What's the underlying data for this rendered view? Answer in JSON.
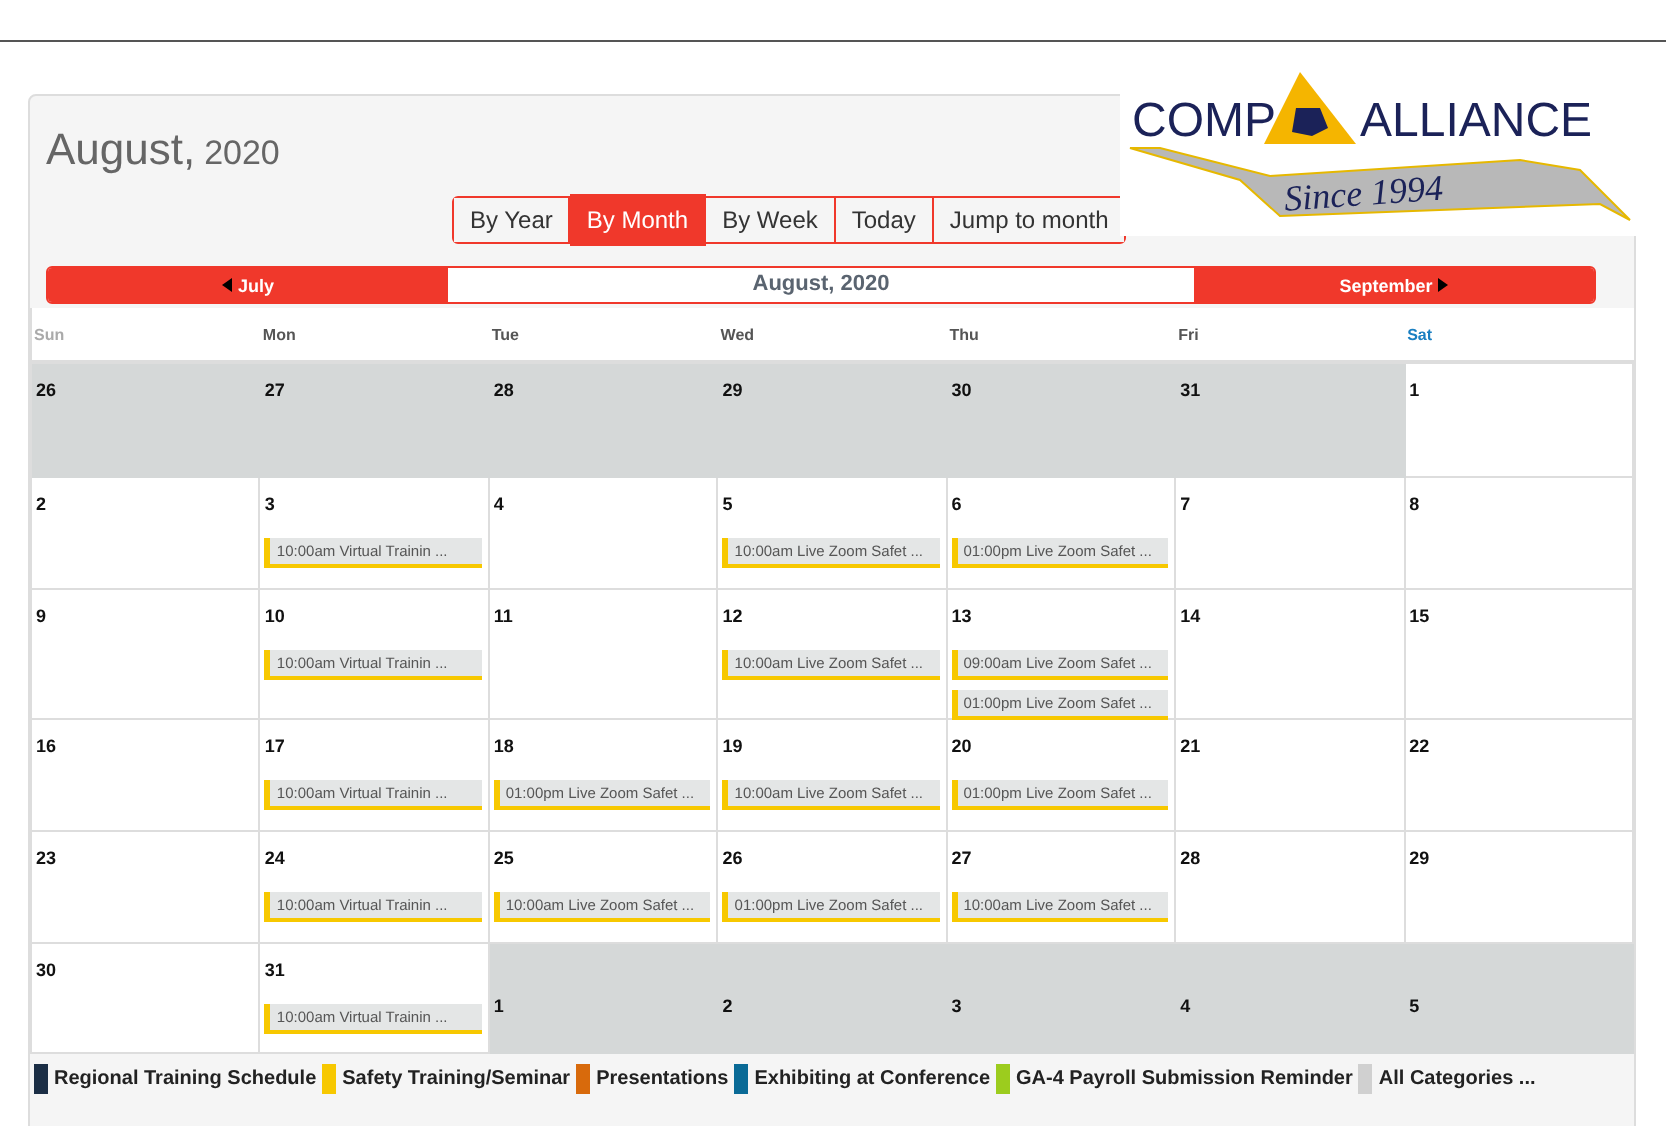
{
  "header": {
    "month": "August,",
    "year": "2020"
  },
  "logo": {
    "left": "COMP",
    "right": "ALLIANCE",
    "banner": "Since 1994"
  },
  "view_tabs": [
    {
      "label": "By Year",
      "selected": false
    },
    {
      "label": "By Month",
      "selected": true
    },
    {
      "label": "By Week",
      "selected": false
    },
    {
      "label": "Today",
      "selected": false
    },
    {
      "label": "Jump to month",
      "selected": false
    }
  ],
  "month_nav": {
    "previous": "July",
    "current": "August, 2020",
    "next": "September"
  },
  "day_headers": [
    {
      "label": "Sun",
      "color": "#aaaaaa"
    },
    {
      "label": "Mon",
      "color": "#555555"
    },
    {
      "label": "Tue",
      "color": "#555555"
    },
    {
      "label": "Wed",
      "color": "#555555"
    },
    {
      "label": "Thu",
      "color": "#555555"
    },
    {
      "label": "Fri",
      "color": "#555555"
    },
    {
      "label": "Sat",
      "color": "#1a7fc1"
    }
  ],
  "weeks": [
    [
      {
        "day": "26",
        "other_month": true
      },
      {
        "day": "27",
        "other_month": true
      },
      {
        "day": "28",
        "other_month": true
      },
      {
        "day": "29",
        "other_month": true
      },
      {
        "day": "30",
        "other_month": true
      },
      {
        "day": "31",
        "other_month": true
      },
      {
        "day": "1",
        "other_month": false
      }
    ],
    [
      {
        "day": "2",
        "other_month": false
      },
      {
        "day": "3",
        "other_month": false,
        "events": [
          {
            "text": "10:00am Virtual Trainin ...",
            "color": "#f7c800"
          }
        ]
      },
      {
        "day": "4",
        "other_month": false
      },
      {
        "day": "5",
        "other_month": false,
        "events": [
          {
            "text": "10:00am Live Zoom Safet ...",
            "color": "#f7c800"
          }
        ]
      },
      {
        "day": "6",
        "other_month": false,
        "events": [
          {
            "text": "01:00pm Live Zoom Safet ...",
            "color": "#f7c800"
          }
        ]
      },
      {
        "day": "7",
        "other_month": false
      },
      {
        "day": "8",
        "other_month": false
      }
    ],
    [
      {
        "day": "9",
        "other_month": false
      },
      {
        "day": "10",
        "other_month": false,
        "events": [
          {
            "text": "10:00am Virtual Trainin ...",
            "color": "#f7c800"
          }
        ]
      },
      {
        "day": "11",
        "other_month": false
      },
      {
        "day": "12",
        "other_month": false,
        "events": [
          {
            "text": "10:00am Live Zoom Safet ...",
            "color": "#f7c800"
          }
        ]
      },
      {
        "day": "13",
        "other_month": false,
        "events": [
          {
            "text": "09:00am Live Zoom Safet ...",
            "color": "#f7c800"
          },
          {
            "text": "01:00pm Live Zoom Safet ...",
            "color": "#f7c800"
          }
        ]
      },
      {
        "day": "14",
        "other_month": false
      },
      {
        "day": "15",
        "other_month": false
      }
    ],
    [
      {
        "day": "16",
        "other_month": false
      },
      {
        "day": "17",
        "other_month": false,
        "events": [
          {
            "text": "10:00am Virtual Trainin ...",
            "color": "#f7c800"
          }
        ]
      },
      {
        "day": "18",
        "other_month": false,
        "events": [
          {
            "text": "01:00pm Live Zoom Safet ...",
            "color": "#f7c800"
          }
        ]
      },
      {
        "day": "19",
        "other_month": false,
        "events": [
          {
            "text": "10:00am Live Zoom Safet ...",
            "color": "#f7c800"
          }
        ]
      },
      {
        "day": "20",
        "other_month": false,
        "events": [
          {
            "text": "01:00pm Live Zoom Safet ...",
            "color": "#f7c800"
          }
        ]
      },
      {
        "day": "21",
        "other_month": false
      },
      {
        "day": "22",
        "other_month": false
      }
    ],
    [
      {
        "day": "23",
        "other_month": false
      },
      {
        "day": "24",
        "other_month": false,
        "events": [
          {
            "text": "10:00am Virtual Trainin ...",
            "color": "#f7c800"
          }
        ]
      },
      {
        "day": "25",
        "other_month": false,
        "events": [
          {
            "text": "10:00am Live Zoom Safet ...",
            "color": "#f7c800"
          }
        ]
      },
      {
        "day": "26",
        "other_month": false,
        "events": [
          {
            "text": "01:00pm Live Zoom Safet ...",
            "color": "#f7c800"
          }
        ]
      },
      {
        "day": "27",
        "other_month": false,
        "events": [
          {
            "text": "10:00am Live Zoom Safet ...",
            "color": "#f7c800"
          }
        ]
      },
      {
        "day": "28",
        "other_month": false
      },
      {
        "day": "29",
        "other_month": false
      }
    ],
    [
      {
        "day": "30",
        "other_month": false
      },
      {
        "day": "31",
        "other_month": false,
        "events": [
          {
            "text": "10:00am Virtual Trainin ...",
            "color": "#f7c800"
          }
        ]
      },
      {
        "day": "1",
        "other_month": true
      },
      {
        "day": "2",
        "other_month": true
      },
      {
        "day": "3",
        "other_month": true
      },
      {
        "day": "4",
        "other_month": true
      },
      {
        "day": "5",
        "other_month": true
      }
    ]
  ],
  "legend": [
    {
      "label": "Regional Training Schedule",
      "color": "#1b2e45"
    },
    {
      "label": "Safety Training/Seminar",
      "color": "#f7c800"
    },
    {
      "label": "Presentations",
      "color": "#d86a0c"
    },
    {
      "label": "Exhibiting at Conference",
      "color": "#0a6a96"
    },
    {
      "label": "GA-4 Payroll Submission Reminder",
      "color": "#9ccc1e"
    },
    {
      "label": "All Categories ...",
      "color": "#d0d0d0"
    }
  ]
}
